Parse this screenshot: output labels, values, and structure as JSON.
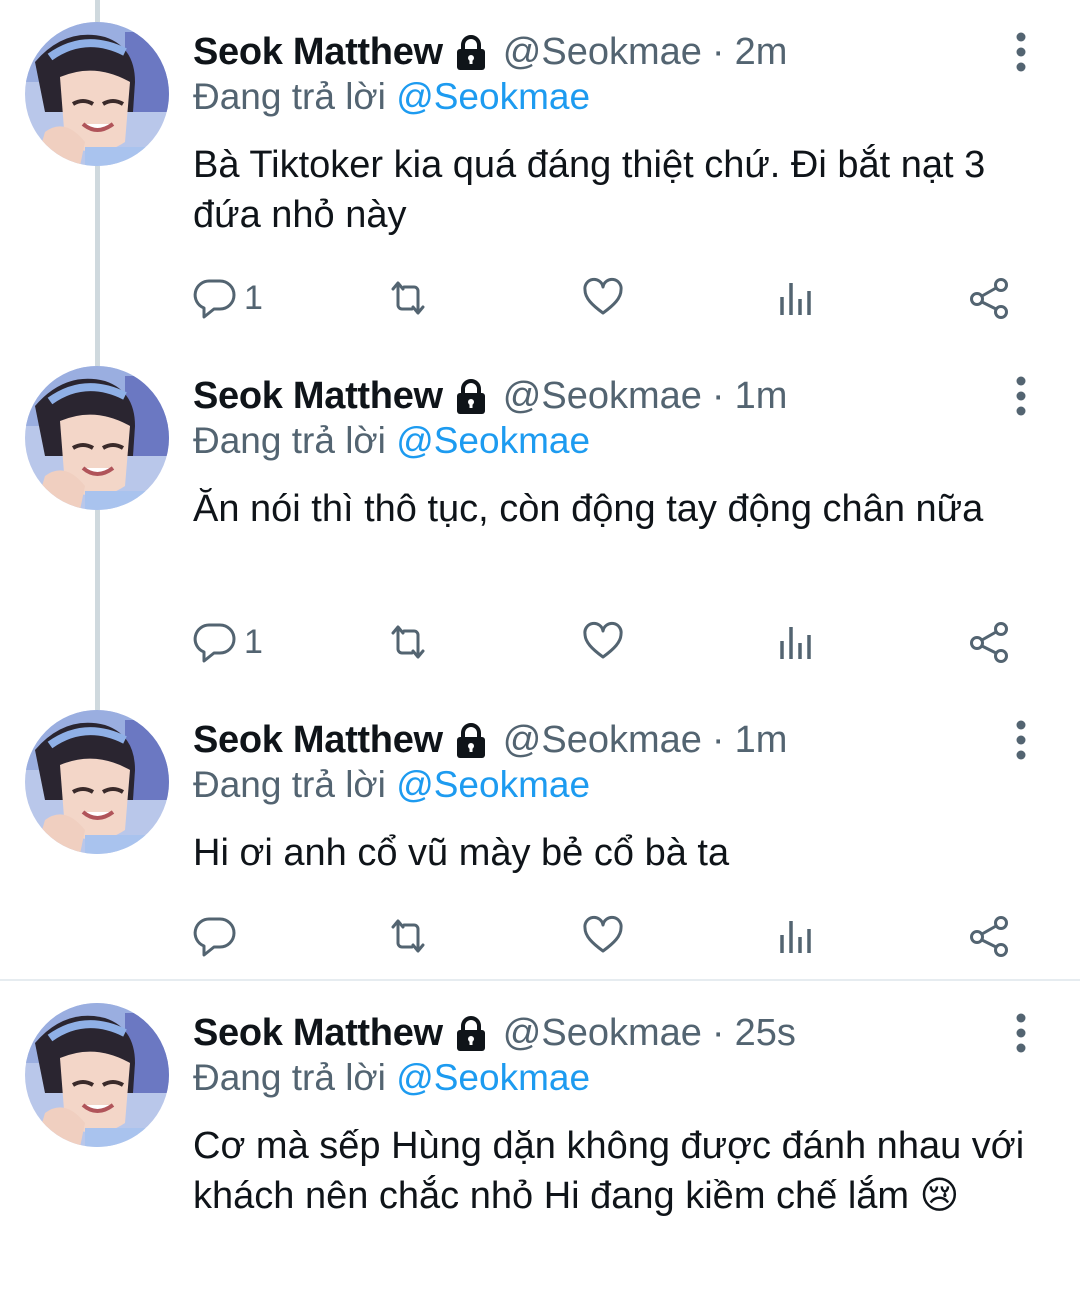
{
  "tweets": [
    {
      "name": "Seok Matthew",
      "handle": "@Seokmae",
      "dot": "·",
      "time": "2m",
      "replying_prefix": "Đang trả lời ",
      "replying_to": "@Seokmae",
      "text": "Bà Tiktoker kia quá đáng thiệt chứ. Đi bắt nạt 3 đứa nhỏ này",
      "reply_count": "1"
    },
    {
      "name": "Seok Matthew",
      "handle": "@Seokmae",
      "dot": "·",
      "time": "1m",
      "replying_prefix": "Đang trả lời ",
      "replying_to": "@Seokmae",
      "text": "Ăn nói thì thô tục, còn động tay động chân nữa",
      "reply_count": "1"
    },
    {
      "name": "Seok Matthew",
      "handle": "@Seokmae",
      "dot": "·",
      "time": "1m",
      "replying_prefix": "Đang trả lời ",
      "replying_to": "@Seokmae",
      "text": "Hi ơi anh cổ vũ mày bẻ cổ bà ta",
      "reply_count": ""
    },
    {
      "name": "Seok Matthew",
      "handle": "@Seokmae",
      "dot": "·",
      "time": "25s",
      "replying_prefix": "Đang trả lời ",
      "replying_to": "@Seokmae",
      "text": "Cơ mà sếp Hùng dặn không được đánh nhau với khách nên chắc nhỏ Hi đang kiềm chế lắm 😢",
      "reply_count": ""
    }
  ],
  "icons": {
    "lock": "lock-icon",
    "more": "more-vertical-icon",
    "reply": "reply-icon",
    "retweet": "retweet-icon",
    "like": "heart-icon",
    "analytics": "analytics-icon",
    "share": "share-icon"
  },
  "colors": {
    "text": "#0f1419",
    "secondary": "#536471",
    "accent": "#1d9bf0",
    "thread_line": "#cfd9de"
  }
}
